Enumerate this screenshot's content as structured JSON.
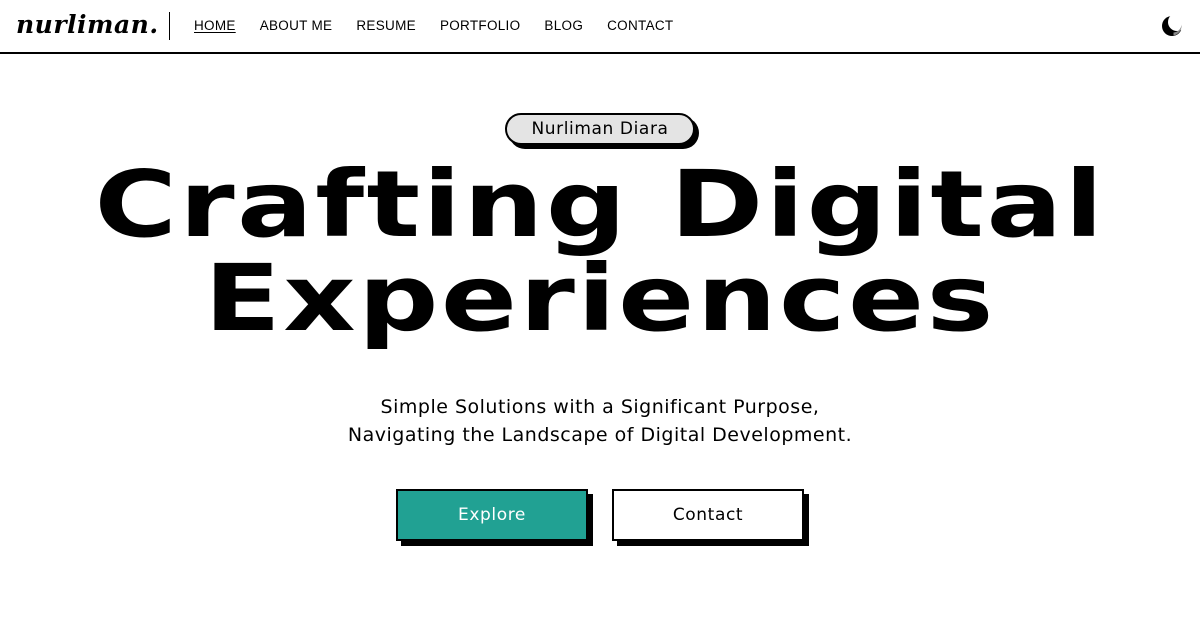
{
  "header": {
    "logo": "nurliman.",
    "nav": [
      {
        "label": "HOME",
        "active": true
      },
      {
        "label": "ABOUT ME",
        "active": false
      },
      {
        "label": "RESUME",
        "active": false
      },
      {
        "label": "PORTFOLIO",
        "active": false
      },
      {
        "label": "BLOG",
        "active": false
      },
      {
        "label": "CONTACT",
        "active": false
      }
    ],
    "theme_toggle_icon": "moon-icon"
  },
  "hero": {
    "badge": "Nurliman Diara",
    "headline": [
      "Crafting Digital",
      "Experiences"
    ],
    "subtitle": [
      "Simple Solutions with a Significant Purpose,",
      "Navigating the Landscape of Digital Development."
    ],
    "buttons": {
      "explore": "Explore",
      "contact": "Contact"
    }
  },
  "colors": {
    "accent": "#21a193",
    "text": "#000000",
    "background": "#ffffff",
    "badge_bg": "#e4e4e4"
  }
}
